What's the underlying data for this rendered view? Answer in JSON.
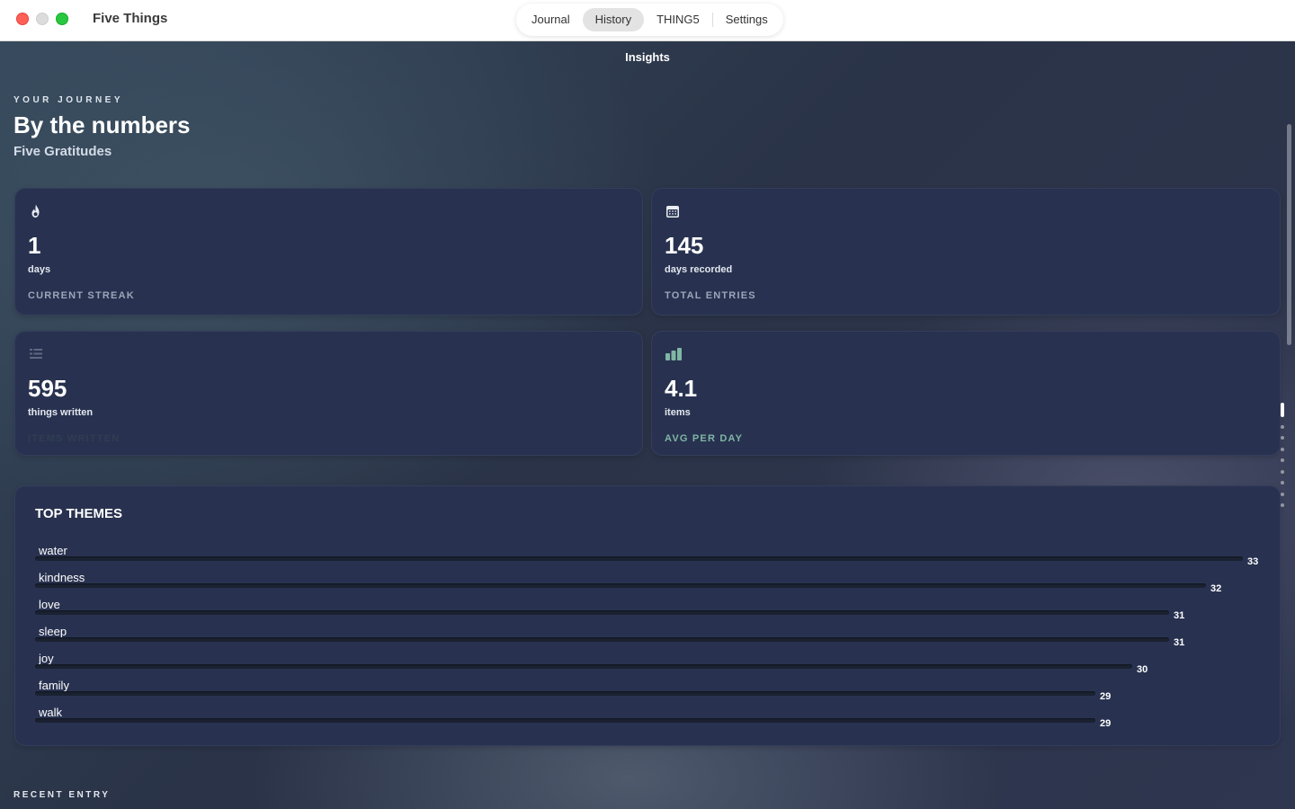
{
  "window": {
    "title": "Five Things",
    "nav": [
      {
        "label": "Journal",
        "active": false
      },
      {
        "label": "History",
        "active": true
      },
      {
        "label": "THING5",
        "active": false
      },
      {
        "label": "Settings",
        "active": false
      }
    ]
  },
  "page": {
    "heading": "Insights",
    "eyebrow": "YOUR JOURNEY",
    "title": "By the numbers",
    "subtitle": "Five Gratitudes"
  },
  "stats": [
    {
      "icon": "flame-icon",
      "value": "1",
      "unit": "days",
      "label": "CURRENT STREAK"
    },
    {
      "icon": "calendar-icon",
      "value": "145",
      "unit": "days recorded",
      "label": "TOTAL ENTRIES"
    },
    {
      "icon": "text-lines-icon",
      "value": "595",
      "unit": "things written",
      "label": "ITEMS WRITTEN"
    },
    {
      "icon": "bar-chart-icon",
      "value": "4.1",
      "unit": "items",
      "label": "AVG PER DAY"
    }
  ],
  "themes": {
    "title": "TOP THEMES",
    "items": [
      {
        "name": "water",
        "count": 33
      },
      {
        "name": "kindness",
        "count": 32
      },
      {
        "name": "love",
        "count": 31
      },
      {
        "name": "sleep",
        "count": 31
      },
      {
        "name": "joy",
        "count": 30
      },
      {
        "name": "family",
        "count": 29
      },
      {
        "name": "walk",
        "count": 29
      }
    ]
  },
  "recent": {
    "label": "RECENT ENTRY"
  },
  "colors": {
    "accent": "#7fb6a4",
    "card": "#283250",
    "close": "#ff5f57",
    "zoom": "#28c840"
  }
}
